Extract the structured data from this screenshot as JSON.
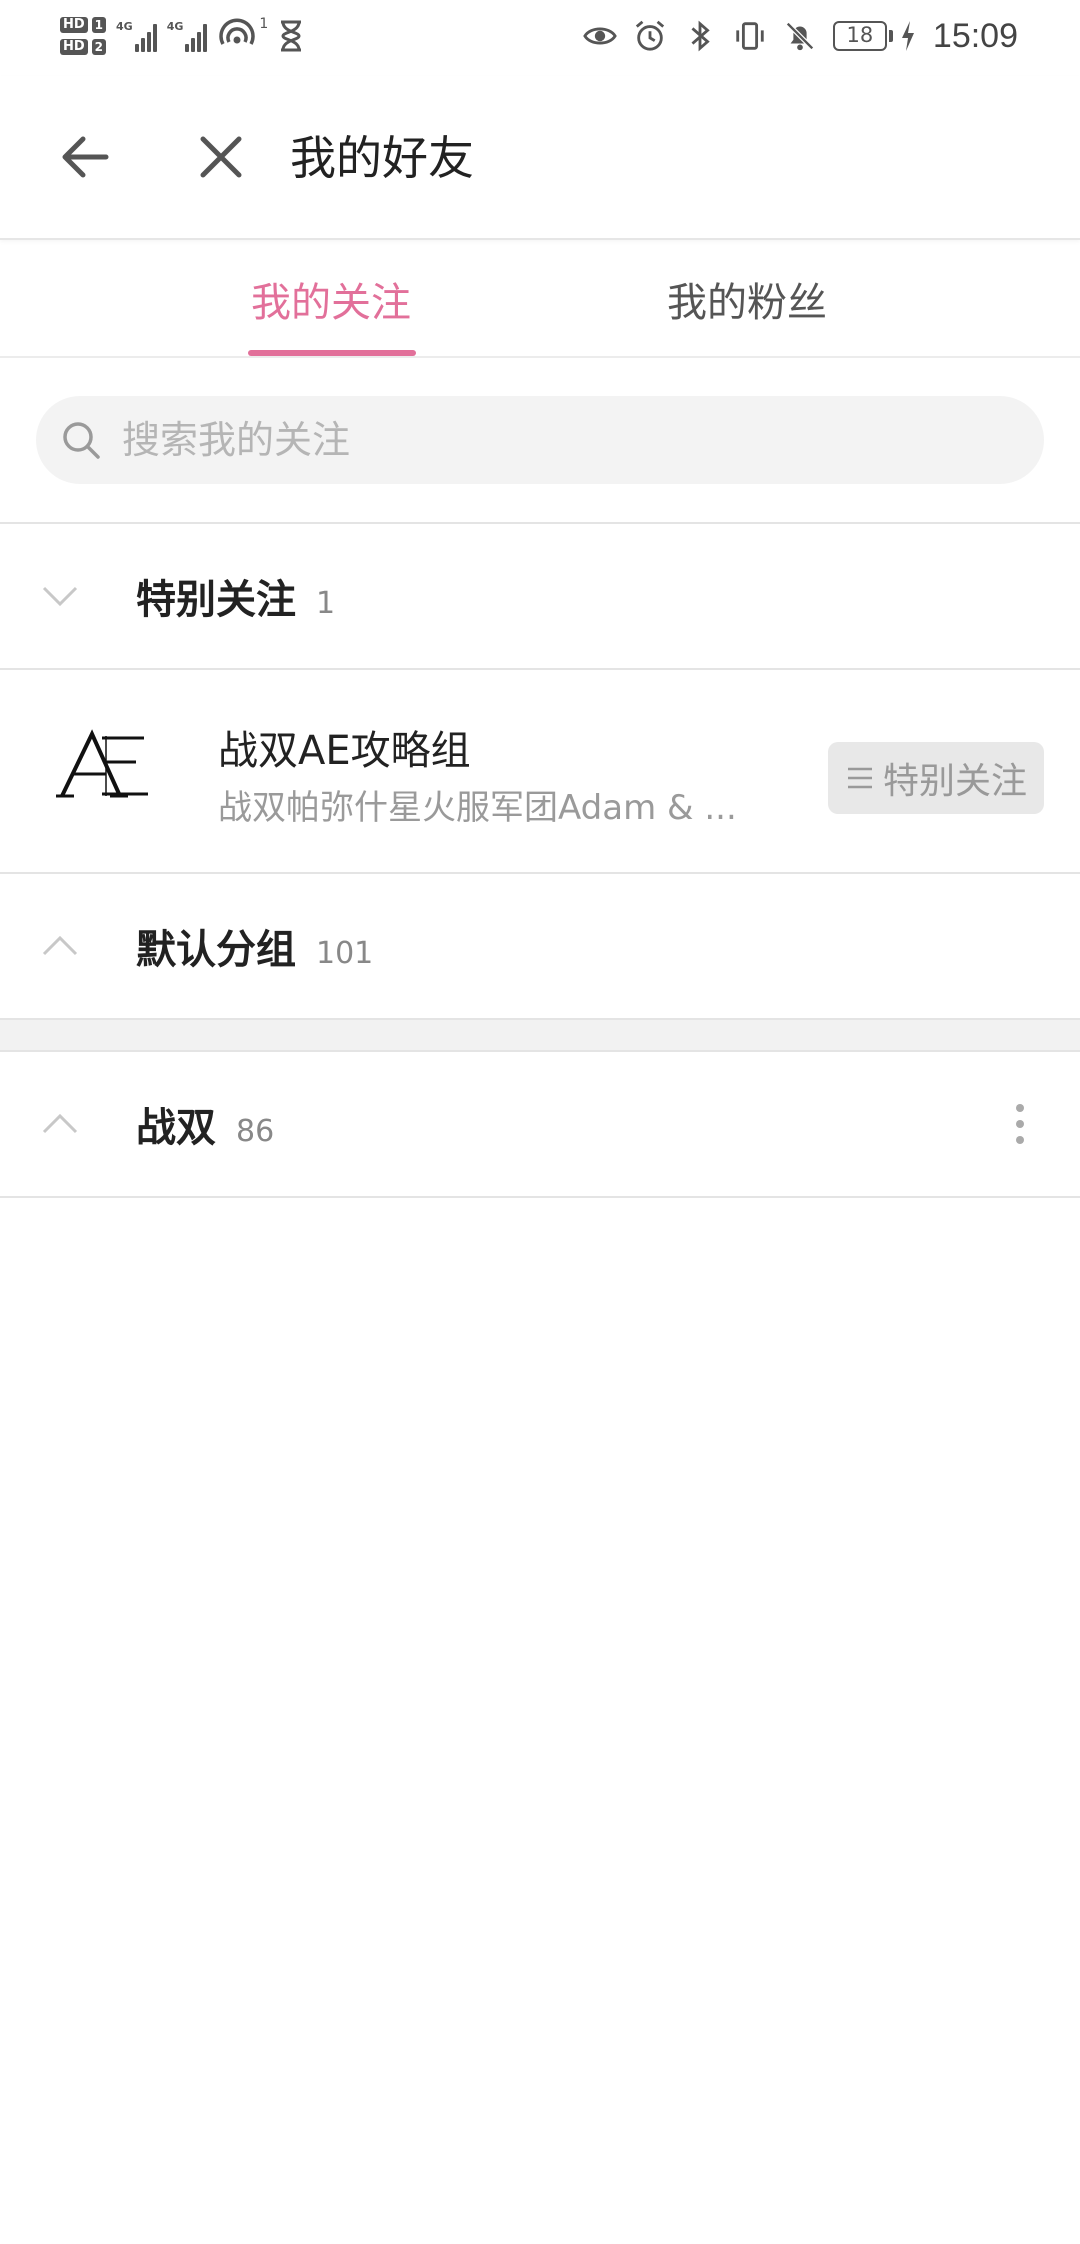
{
  "status_bar": {
    "sim1": "HD",
    "sim1_slot": "1",
    "sim2": "HD",
    "sim2_slot": "2",
    "net1": "4G",
    "net2": "4G",
    "hotspot_count": "1",
    "battery": "18",
    "time": "15:09",
    "icons": [
      "eye-icon",
      "alarm-icon",
      "bluetooth-icon",
      "vibrate-icon",
      "mute-icon",
      "charging-icon"
    ]
  },
  "header": {
    "title": "我的好友"
  },
  "tabs": [
    {
      "label": "我的关注",
      "active": true
    },
    {
      "label": "我的粉丝",
      "active": false
    }
  ],
  "search": {
    "placeholder": "搜索我的关注",
    "value": ""
  },
  "groups": [
    {
      "name": "特别关注",
      "count": "1",
      "expanded": true
    },
    {
      "name": "默认分组",
      "count": "101",
      "expanded": false
    },
    {
      "name": "战双",
      "count": "86",
      "expanded": false
    }
  ],
  "special_users": [
    {
      "name": "战双AE攻略组",
      "description": "战双帕弥什星火服军团Adam & ...",
      "action_label": "特别关注"
    }
  ],
  "colors": {
    "accent": "#e2709a",
    "divider": "#e4e4e4",
    "muted_text": "#9a9a9a"
  }
}
